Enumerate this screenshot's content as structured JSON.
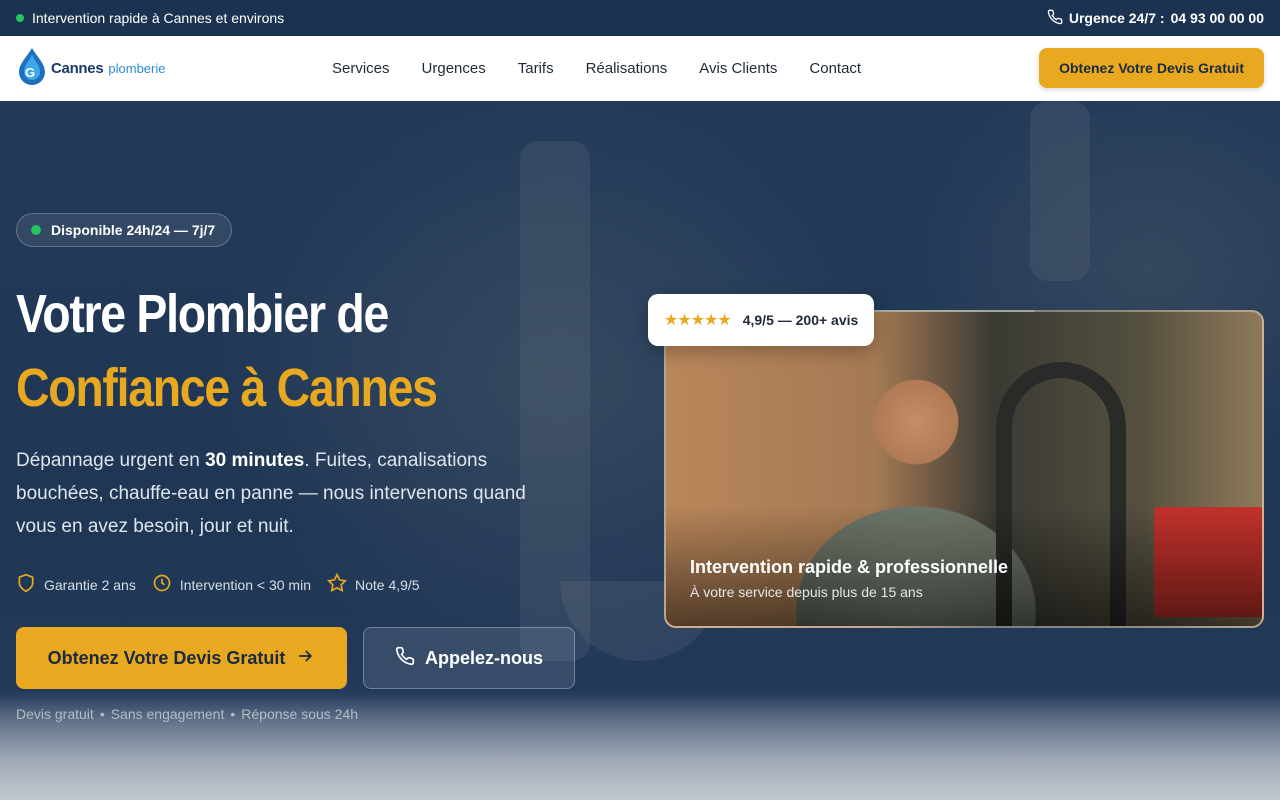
{
  "topbar": {
    "left_text": "Intervention rapide à Cannes et environs",
    "right_label": "Urgence 24/7 :",
    "phone": "04 93 00 00 00"
  },
  "header": {
    "logo_primary": "Cannes",
    "logo_secondary": "plomberie",
    "nav": [
      "Services",
      "Urgences",
      "Tarifs",
      "Réalisations",
      "Avis Clients",
      "Contact"
    ],
    "cta": "Obtenez Votre Devis Gratuit"
  },
  "hero": {
    "badge": "Disponible 24h/24 — 7j/7",
    "title_line1": "Votre Plombier de",
    "title_line2": "Confiance à Cannes",
    "lead_pre": "Dépannage urgent en ",
    "lead_strong": "30 minutes",
    "lead_post": ". Fuites, canalisations bouchées, chauffe-eau en panne — nous intervenons quand vous en avez besoin, jour et nuit.",
    "features": [
      "Garantie 2 ans",
      "Intervention < 30 min",
      "Note 4,9/5"
    ],
    "btn_primary": "Obtenez Votre Devis Gratuit",
    "btn_secondary": "Appelez-nous",
    "fineprint": [
      "Devis gratuit",
      "•",
      "Sans engagement",
      "•",
      "Réponse sous 24h"
    ]
  },
  "card": {
    "caption": "Intervention rapide & professionnelle",
    "subcaption": "À votre service depuis plus de 15 ans",
    "rating_stars": "★★★★★",
    "rating_text": "4,9/5 — 200+ avis"
  },
  "colors": {
    "accent": "#e8a820",
    "navy": "#1b3350",
    "status_green": "#22c55e"
  }
}
